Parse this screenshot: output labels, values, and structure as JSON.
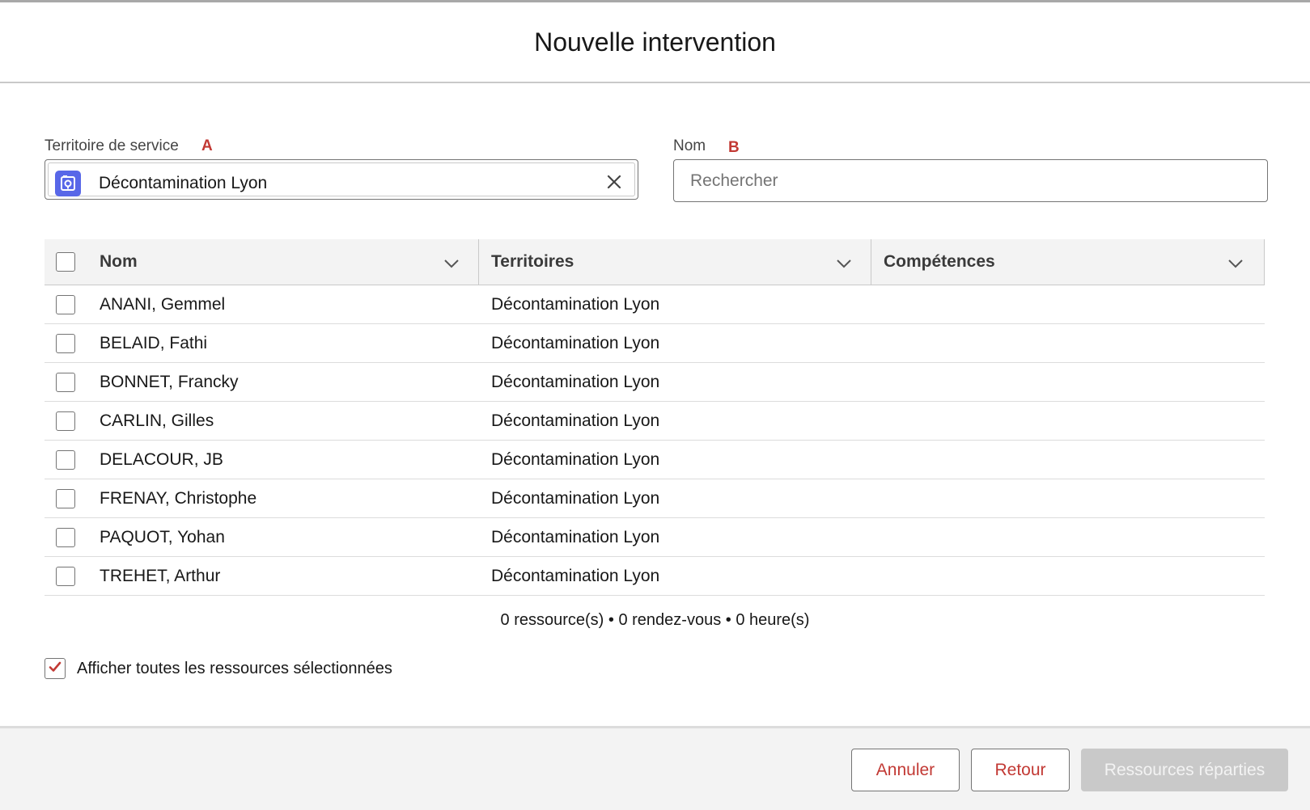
{
  "modal": {
    "title": "Nouvelle intervention"
  },
  "service_territory": {
    "label": "Territoire de service",
    "marker": "A",
    "value": "Décontamination Lyon",
    "icon": "service-territory-icon"
  },
  "name_search": {
    "label": "Nom",
    "marker": "B",
    "placeholder": "Rechercher",
    "value": ""
  },
  "table": {
    "columns": [
      "Nom",
      "Territoires",
      "Compétences"
    ],
    "rows": [
      {
        "name": "ANANI, Gemmel",
        "territory": "Décontamination Lyon",
        "skills": "",
        "checked": false
      },
      {
        "name": "BELAID, Fathi",
        "territory": "Décontamination Lyon",
        "skills": "",
        "checked": false
      },
      {
        "name": "BONNET, Francky",
        "territory": "Décontamination Lyon",
        "skills": "",
        "checked": false
      },
      {
        "name": "CARLIN, Gilles",
        "territory": "Décontamination Lyon",
        "skills": "",
        "checked": false
      },
      {
        "name": "DELACOUR, JB",
        "territory": "Décontamination Lyon",
        "skills": "",
        "checked": false
      },
      {
        "name": "FRENAY, Christophe",
        "territory": "Décontamination Lyon",
        "skills": "",
        "checked": false
      },
      {
        "name": "PAQUOT, Yohan",
        "territory": "Décontamination Lyon",
        "skills": "",
        "checked": false
      },
      {
        "name": "TREHET, Arthur",
        "territory": "Décontamination Lyon",
        "skills": "",
        "checked": false
      }
    ]
  },
  "summary": "0 ressource(s) • 0 rendez-vous • 0 heure(s)",
  "show_all_selected": {
    "label": "Afficher toutes les ressources sélectionnées",
    "checked": true
  },
  "footer": {
    "cancel_label": "Annuler",
    "back_label": "Retour",
    "distribute_label": "Ressources réparties",
    "distribute_disabled": true
  },
  "colors": {
    "accent_red": "#c23934",
    "icon_blue": "#5867e8",
    "disabled_button": "#c9c9c9"
  }
}
